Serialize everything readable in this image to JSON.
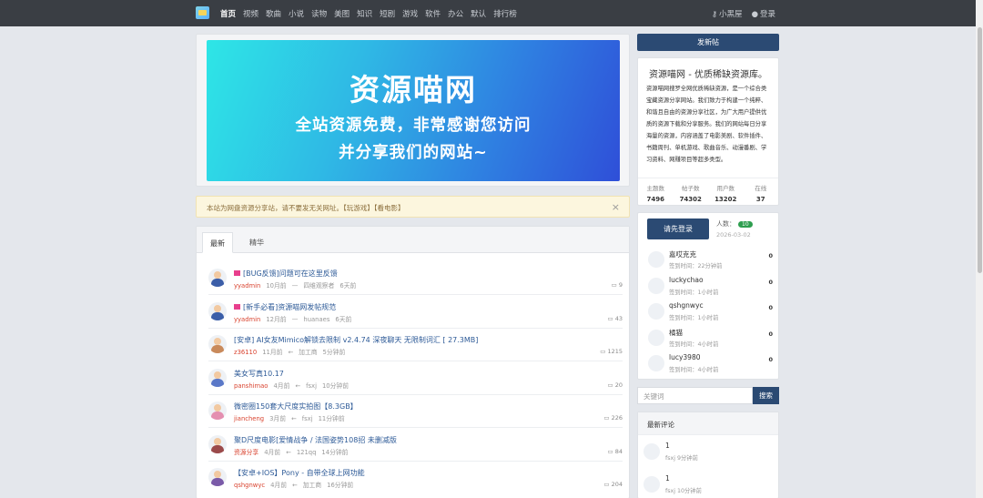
{
  "nav": {
    "items": [
      "首页",
      "视频",
      "歌曲",
      "小说",
      "读物",
      "美图",
      "知识",
      "短剧",
      "游戏",
      "软件",
      "办公",
      "默认",
      "排行榜"
    ],
    "user_label": "小黑屋",
    "login_label": "登录"
  },
  "banner": {
    "title": "资源喵网",
    "line1": "全站资源免费，非常感谢您访问",
    "line2": "并分享我们的网站~"
  },
  "notice": {
    "text": "本站为网盘资源分享站，请不要发无关网址。",
    "link1": "【玩游戏】",
    "link2": "【看电影】",
    "close": "×"
  },
  "feed": {
    "tabs": [
      "最新",
      "精华"
    ],
    "posts": [
      {
        "title": "[BUG反馈]问题可在这里反馈",
        "user": "yyadmin",
        "time": "10月前",
        "sep": "—",
        "last_user": "四维观察者",
        "last_time": "6天前",
        "count": "9",
        "flag": true
      },
      {
        "title": "[新手必看]资源喵网发帖规范",
        "user": "yyadmin",
        "time": "12月前",
        "sep": "—",
        "last_user": "huanaes",
        "last_time": "6天前",
        "count": "43",
        "flag": true
      },
      {
        "title": "[安卓] AI女友Mimico解锁去限制 v2.4.74 深夜聊天 无限制词汇 [ 27.3MB]",
        "user": "z36110",
        "time": "11月前",
        "sep": "←",
        "last_user": "加工商",
        "last_time": "5分钟前",
        "count": "1215",
        "flag": false
      },
      {
        "title": "美女写真10.17",
        "user": "panshimao",
        "time": "4月前",
        "sep": "←",
        "last_user": "fsxj",
        "last_time": "10分钟前",
        "count": "20",
        "flag": false
      },
      {
        "title": "微密圈150套大尺度实拍图【8.3GB】",
        "user": "jiancheng",
        "time": "3月前",
        "sep": "←",
        "last_user": "fsxj",
        "last_time": "11分钟前",
        "count": "226",
        "flag": false
      },
      {
        "title": "聚D尺度电影[爱情战争 / 法国姿势108招 未删减版",
        "user": "资源分享",
        "time": "4月前",
        "sep": "←",
        "last_user": "121qq",
        "last_time": "14分钟前",
        "count": "84",
        "flag": false
      },
      {
        "title": "【安卓+IOS】Pony - 自带全球上网功能",
        "user": "qshgnwyc",
        "time": "4月前",
        "sep": "←",
        "last_user": "加工商",
        "last_time": "16分钟前",
        "count": "204",
        "flag": false
      }
    ]
  },
  "sidebar": {
    "post_button": "发新帖",
    "about_title": "资源喵网 - 优质稀缺资源库。",
    "about_text": "资源喵网搜罗全网优质稀缺资源，是一个综合类宝藏资源分享网站。我们致力于构建一个纯粹、和谐且自由的资源分享社区，为广大用户提供优质的资源下载和分享服务。我们的网站每日分享海量的资源，内容涵盖了电影美剧、软件插件、书籍周刊、单机游戏、歌曲音乐、动漫番剧、学习资料、网赚项目等超多类型。",
    "stats": [
      {
        "label": "主题数",
        "value": "7496"
      },
      {
        "label": "帖子数",
        "value": "74302"
      },
      {
        "label": "用户数",
        "value": "13202"
      },
      {
        "label": "在线",
        "value": "37"
      }
    ],
    "login_button": "请先登录",
    "online_label": "人数：",
    "online_badge": "10",
    "online_date": "2026-03-02",
    "online_users": [
      {
        "name": "嘉哎克克",
        "sub": "签到时间：22分钟前",
        "n": "0"
      },
      {
        "name": "luckychao",
        "sub": "签到时间：1小时前",
        "n": "0"
      },
      {
        "name": "qshgnwyc",
        "sub": "签到时间：1小时前",
        "n": "0"
      },
      {
        "name": "橘猫",
        "sub": "签到时间：4小时前",
        "n": "0"
      },
      {
        "name": "lucy3980",
        "sub": "签到时间：4小时前",
        "n": "0"
      }
    ],
    "search_placeholder": "关键词",
    "search_button": "搜索",
    "comments_title": "最新评论",
    "comments": [
      {
        "text": "1",
        "sub": "fsxj  9分钟前"
      },
      {
        "text": "1",
        "sub": "fsxj  10分钟前"
      }
    ]
  }
}
